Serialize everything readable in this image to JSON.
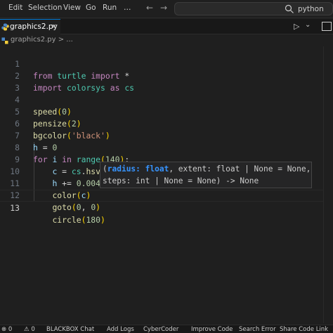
{
  "menu": {
    "items": [
      "Edit",
      "Selection",
      "View",
      "Go",
      "Run",
      "…"
    ]
  },
  "nav": {
    "back_icon": "arrow-left-icon",
    "forward_icon": "arrow-right-icon"
  },
  "search": {
    "text": "python",
    "icon": "search-icon"
  },
  "tab": {
    "label": "graphics2.py",
    "close_glyph": "×",
    "icon": "python-icon"
  },
  "toolbar": {
    "run_glyph": "▷",
    "chevron_glyph": "⌄"
  },
  "breadcrumb": {
    "text": "graphics2.py > ..."
  },
  "editor": {
    "active_line": 13,
    "line_numbers": [
      "1",
      "2",
      "3",
      "4",
      "5",
      "6",
      "7",
      "8",
      "9",
      "10",
      "11",
      "12",
      "13"
    ]
  },
  "signature_help": {
    "line1_open": "(",
    "param": "radius: float",
    "line1_rest": ", extent: float | None = None,",
    "line2": "steps: int | None = None) -> None"
  },
  "statusbar": {
    "items": [
      "⊗ 0",
      "⚠ 0",
      "BLACKBOX Chat",
      "Add Logs",
      "CyberCoder",
      "Improve Code",
      "Search Error",
      "Share Code Link"
    ]
  },
  "colors": {
    "background": "#1f1f1f",
    "keyword": "#c586c0",
    "function": "#dcdcaa",
    "string": "#ce9178",
    "number": "#b5cea8",
    "accent": "#0078d4"
  }
}
